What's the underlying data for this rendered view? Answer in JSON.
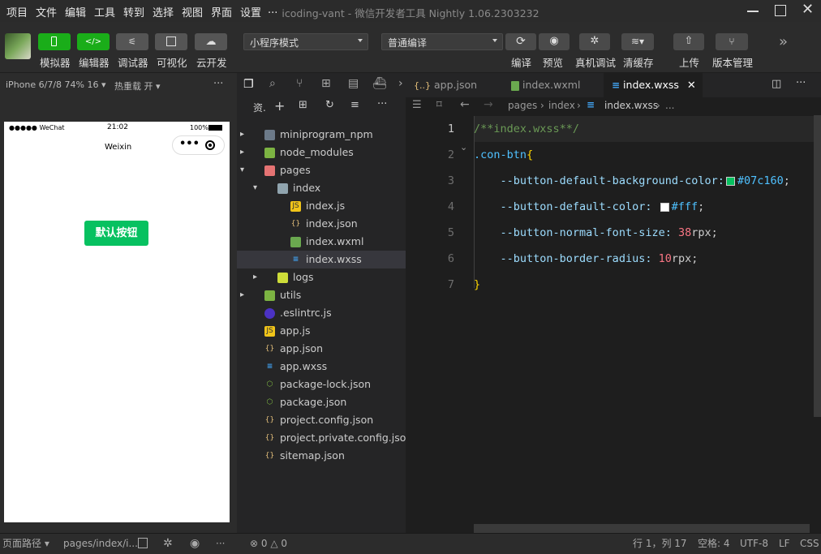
{
  "menu": [
    "项目",
    "文件",
    "编辑",
    "工具",
    "转到",
    "选择",
    "视图",
    "界面",
    "设置",
    "..."
  ],
  "window_title": "icoding-vant - 微信开发者工具 Nightly 1.06.2303232",
  "toolbar": {
    "left_buttons": [
      "模拟器",
      "编辑器",
      "调试器",
      "可视化",
      "云开发"
    ],
    "mode_select": "小程序模式",
    "compile_select": "普通编译",
    "right_buttons": [
      "编译",
      "预览",
      "真机调试",
      "清缓存",
      "上传",
      "版本管理"
    ]
  },
  "simulator": {
    "device": "iPhone 6/7/8 74% 16",
    "hot_reload": "热重载 开",
    "more": "···",
    "status_left": "●●●●● WeChat",
    "status_time": "21:02",
    "status_battery": "100%",
    "nav_title": "Weixin",
    "capsule_dots": "•••",
    "button_label": "默认按钮",
    "button_color": "#07c160"
  },
  "explorer": {
    "header": "资.",
    "items": [
      {
        "name": "miniprogram_npm",
        "type": "folder",
        "level": 0,
        "arrow": "▸"
      },
      {
        "name": "node_modules",
        "type": "folder-green",
        "level": 0,
        "arrow": "▸"
      },
      {
        "name": "pages",
        "type": "folder-red",
        "level": 0,
        "arrow": "▾"
      },
      {
        "name": "index",
        "type": "folder-open",
        "level": 1,
        "arrow": "▾"
      },
      {
        "name": "index.js",
        "type": "js",
        "level": 2,
        "arrow": ""
      },
      {
        "name": "index.json",
        "type": "json",
        "level": 2,
        "arrow": ""
      },
      {
        "name": "index.wxml",
        "type": "wxml",
        "level": 2,
        "arrow": ""
      },
      {
        "name": "index.wxss",
        "type": "wxss",
        "level": 2,
        "arrow": "",
        "selected": true
      },
      {
        "name": "logs",
        "type": "folder-yellow",
        "level": 1,
        "arrow": "▸"
      },
      {
        "name": "utils",
        "type": "folder-green",
        "level": 0,
        "arrow": "▸"
      },
      {
        "name": ".eslintrc.js",
        "type": "eslint",
        "level": 0,
        "arrow": ""
      },
      {
        "name": "app.js",
        "type": "js",
        "level": 0,
        "arrow": ""
      },
      {
        "name": "app.json",
        "type": "json",
        "level": 0,
        "arrow": ""
      },
      {
        "name": "app.wxss",
        "type": "wxss",
        "level": 0,
        "arrow": ""
      },
      {
        "name": "package-lock.json",
        "type": "node",
        "level": 0,
        "arrow": ""
      },
      {
        "name": "package.json",
        "type": "node",
        "level": 0,
        "arrow": ""
      },
      {
        "name": "project.config.json",
        "type": "json",
        "level": 0,
        "arrow": ""
      },
      {
        "name": "project.private.config.json",
        "type": "json",
        "level": 0,
        "arrow": ""
      },
      {
        "name": "sitemap.json",
        "type": "json",
        "level": 0,
        "arrow": ""
      }
    ]
  },
  "tabs": [
    {
      "label": "app.json",
      "icon": "{..}",
      "active": false
    },
    {
      "label": "index.wxml",
      "icon": "wxml",
      "active": false
    },
    {
      "label": "index.wxss",
      "icon": "wxss",
      "active": true
    }
  ],
  "breadcrumb": [
    "pages",
    "index",
    "index.wxss",
    "..."
  ],
  "code": {
    "line_numbers": [
      "1",
      "2",
      "3",
      "4",
      "5",
      "6",
      "7"
    ],
    "line1": "/**index.wxss**/",
    "line2_selector": ".con-btn",
    "line2_brace": "{",
    "line3_prop": "--button-default-background-color:",
    "line3_value": "#07c160",
    "line3_end": ";",
    "line4_prop": "--button-default-color: ",
    "line4_value": "#fff",
    "line4_end": ";",
    "line5_prop": "--button-normal-font-size: ",
    "line5_num": "38",
    "line5_unit": "rpx;",
    "line6_prop": "--button-border-radius: ",
    "line6_num": "10",
    "line6_unit": "rpx;",
    "line7": "}",
    "swatch1": "#07c160",
    "swatch2": "#ffffff"
  },
  "status": {
    "page_path_label": "页面路径",
    "page_path": "pages/index/i...",
    "errors": "0",
    "warnings": "0",
    "position": "行 1，列 17",
    "spaces": "空格: 4",
    "encoding": "UTF-8",
    "eol": "LF",
    "language": "CSS"
  }
}
